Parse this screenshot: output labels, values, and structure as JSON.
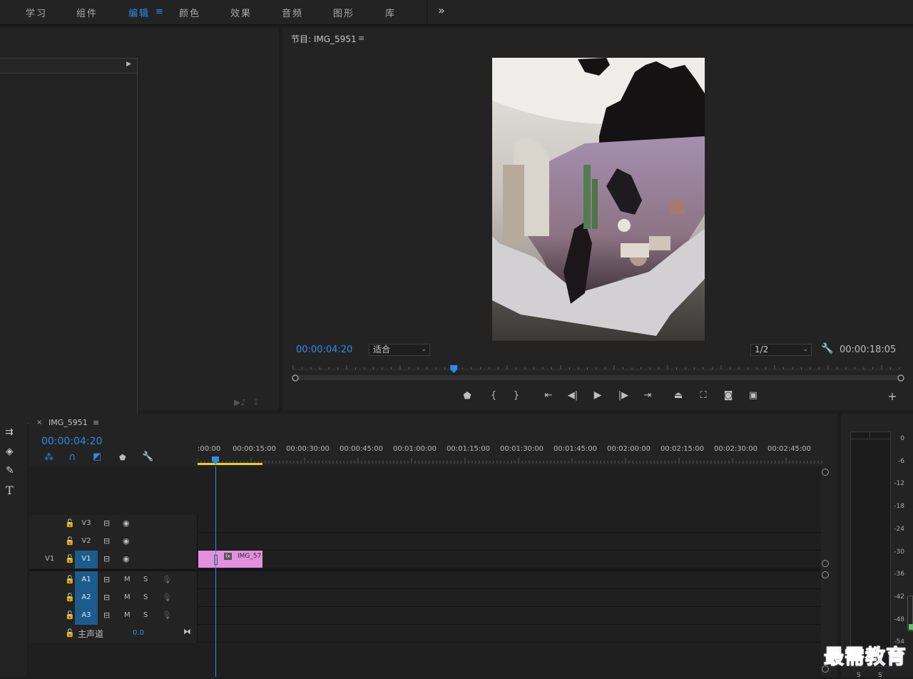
{
  "workspace_tabs": [
    "学习",
    "组件",
    "编辑",
    "颜色",
    "效果",
    "音频",
    "图形",
    "库"
  ],
  "workspace_active": "编辑",
  "overflow_icon": "»",
  "program": {
    "title": "节目: IMG_5951",
    "timecode_current": "00:00:04:20",
    "zoom_value": "适合",
    "resolution_value": "1/2",
    "timecode_duration": "00:00:18:05",
    "playhead_fraction": 0.265
  },
  "timeline": {
    "sequence_name": "IMG_5951",
    "timecode": "00:00:04:20",
    "ruler_labels": [
      ":00:00",
      "00:00:15:00",
      "00:00:30:00",
      "00:00:45:00",
      "00:01:00:00",
      "00:01:15:00",
      "00:01:30:00",
      "00:01:45:00",
      "00:02:00:00",
      "00:02:15:00",
      "00:02:30:00",
      "00:02:45:00"
    ],
    "video_tracks": [
      {
        "name": "V3",
        "selected": false
      },
      {
        "name": "V2",
        "selected": false
      },
      {
        "name": "V1",
        "selected": true,
        "source": "V1"
      }
    ],
    "audio_tracks": [
      {
        "name": "A1",
        "mute": "M",
        "solo": "S"
      },
      {
        "name": "A2",
        "mute": "M",
        "solo": "S"
      },
      {
        "name": "A3",
        "mute": "M",
        "solo": "S"
      }
    ],
    "master": {
      "label": "主声道",
      "value": "0.0"
    },
    "clip": {
      "label": "IMG_57",
      "fx": "fx",
      "color": "#e58fdf"
    }
  },
  "meter": {
    "ticks": [
      "0",
      "-6",
      "-12",
      "-18",
      "-24",
      "-30",
      "-36",
      "-42",
      "-48",
      "-54"
    ],
    "solo_labels": [
      "S",
      "S"
    ]
  },
  "watermark": "最需教育",
  "colors": {
    "accent": "#2d8ceb",
    "clip": "#e58fdf",
    "workarea": "#e4d41a"
  }
}
